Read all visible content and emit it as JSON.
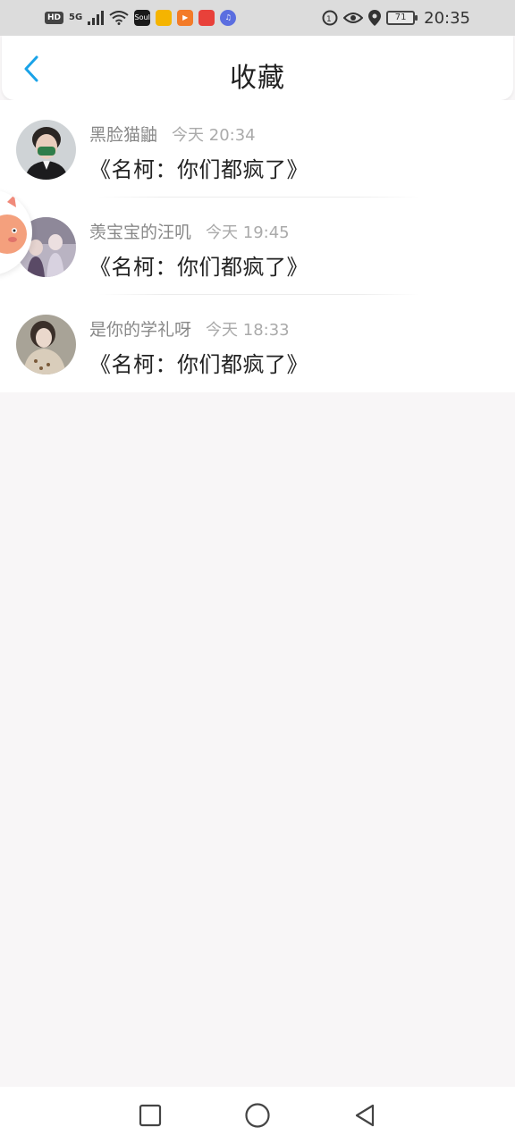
{
  "status_bar": {
    "hd_badge": "HD",
    "network": "5G",
    "apps": [
      {
        "name": "soul-app-icon",
        "label": "Soul",
        "color": "#1a1a1a"
      },
      {
        "name": "yellow-app-icon",
        "label": "",
        "color": "#f5b400"
      },
      {
        "name": "play-app-icon",
        "label": "",
        "color": "#f37b28"
      },
      {
        "name": "red-app-icon",
        "label": "",
        "color": "#e8413a"
      },
      {
        "name": "music-app-icon",
        "label": "",
        "color": "#5b6ee0"
      }
    ],
    "battery": "71",
    "time": "20:35"
  },
  "header": {
    "title": "收藏",
    "accent_color": "#1aa3e8"
  },
  "favorites": [
    {
      "author": "黑脸猫鼬",
      "time": "今天 20:34",
      "content": "《名柯：你们都疯了》"
    },
    {
      "author": "羡宝宝的汪叽",
      "time": "今天 19:45",
      "content": "《名柯：你们都疯了》"
    },
    {
      "author": "是你的学礼呀",
      "time": "今天 18:33",
      "content": "《名柯：你们都疯了》"
    }
  ]
}
